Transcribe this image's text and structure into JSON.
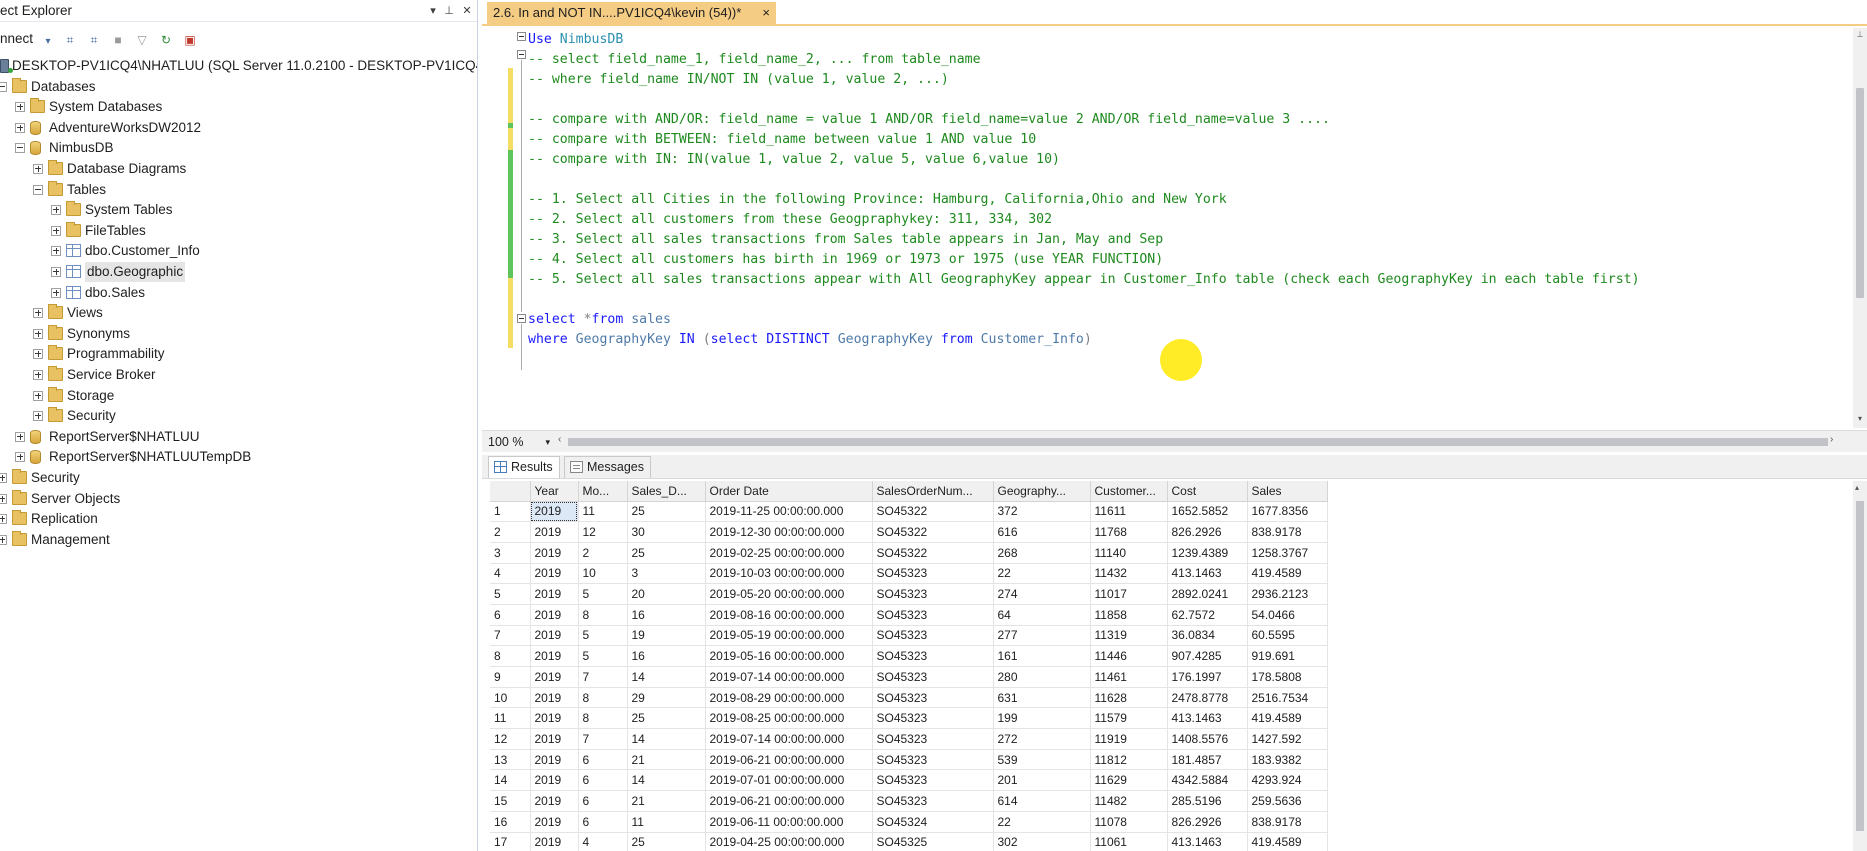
{
  "object_explorer": {
    "title": "ect Explorer",
    "connect_label": "nnect",
    "tree": [
      {
        "label": "DESKTOP-PV1ICQ4\\NHATLUU (SQL Server 11.0.2100 - DESKTOP-PV1ICQ4\\N",
        "icon": "server-icon",
        "level": 0,
        "expander": "none"
      },
      {
        "label": "Databases",
        "icon": "folder-icon",
        "level": 0,
        "expander": "minus"
      },
      {
        "label": "System Databases",
        "icon": "folder-icon",
        "level": 1,
        "expander": "plus"
      },
      {
        "label": "AdventureWorksDW2012",
        "icon": "database-icon",
        "level": 1,
        "expander": "plus"
      },
      {
        "label": "NimbusDB",
        "icon": "database-icon",
        "level": 1,
        "expander": "minus"
      },
      {
        "label": "Database Diagrams",
        "icon": "folder-icon",
        "level": 2,
        "expander": "plus"
      },
      {
        "label": "Tables",
        "icon": "folder-icon",
        "level": 2,
        "expander": "minus"
      },
      {
        "label": "System Tables",
        "icon": "folder-icon",
        "level": 3,
        "expander": "plus"
      },
      {
        "label": "FileTables",
        "icon": "folder-icon",
        "level": 3,
        "expander": "plus"
      },
      {
        "label": "dbo.Customer_Info",
        "icon": "table-icon",
        "level": 3,
        "expander": "plus"
      },
      {
        "label": "dbo.Geographic",
        "icon": "table-icon",
        "level": 3,
        "expander": "plus",
        "selected": true
      },
      {
        "label": "dbo.Sales",
        "icon": "table-icon",
        "level": 3,
        "expander": "plus"
      },
      {
        "label": "Views",
        "icon": "folder-icon",
        "level": 2,
        "expander": "plus"
      },
      {
        "label": "Synonyms",
        "icon": "folder-icon",
        "level": 2,
        "expander": "plus"
      },
      {
        "label": "Programmability",
        "icon": "folder-icon",
        "level": 2,
        "expander": "plus"
      },
      {
        "label": "Service Broker",
        "icon": "folder-icon",
        "level": 2,
        "expander": "plus"
      },
      {
        "label": "Storage",
        "icon": "folder-icon",
        "level": 2,
        "expander": "plus"
      },
      {
        "label": "Security",
        "icon": "folder-icon",
        "level": 2,
        "expander": "plus"
      },
      {
        "label": "ReportServer$NHATLUU",
        "icon": "database-icon",
        "level": 1,
        "expander": "plus"
      },
      {
        "label": "ReportServer$NHATLUUTempDB",
        "icon": "database-icon",
        "level": 1,
        "expander": "plus"
      },
      {
        "label": "Security",
        "icon": "folder-icon",
        "level": 0,
        "expander": "plus"
      },
      {
        "label": "Server Objects",
        "icon": "folder-icon",
        "level": 0,
        "expander": "plus"
      },
      {
        "label": "Replication",
        "icon": "folder-icon",
        "level": 0,
        "expander": "plus"
      },
      {
        "label": "Management",
        "icon": "folder-icon",
        "level": 0,
        "expander": "plus"
      }
    ]
  },
  "document": {
    "tab_title": "2.6. In and NOT IN....PV1ICQ4\\kevin (54))*",
    "tab_close": "×",
    "zoom": "100 %",
    "code_lines": [
      [
        {
          "t": "Use ",
          "c": "kw"
        },
        {
          "t": "NimbusDB",
          "c": "id"
        }
      ],
      [
        {
          "t": "-- select field_name_1, field_name_2, ... from table_name",
          "c": "cm"
        }
      ],
      [
        {
          "t": "-- where field_name IN/NOT IN (value 1, value 2, ...)",
          "c": "cm"
        }
      ],
      [],
      [
        {
          "t": "-- compare with AND/OR: field_name = value 1 AND/OR field_name=value 2 AND/OR field_name=value 3 ....",
          "c": "cm"
        }
      ],
      [
        {
          "t": "-- compare with BETWEEN: field_name between value 1 AND value 10",
          "c": "cm"
        }
      ],
      [
        {
          "t": "-- compare with IN: IN(value 1, value 2, value 5, value 6,value 10)",
          "c": "cm"
        }
      ],
      [],
      [
        {
          "t": "-- 1. Select all Cities in the following Province: Hamburg, California,Ohio and New York",
          "c": "cm"
        }
      ],
      [
        {
          "t": "-- 2. Select all customers from these Geogpraphykey: 311, 334, 302",
          "c": "cm"
        }
      ],
      [
        {
          "t": "-- 3. Select all sales transactions from Sales table appears in Jan, May and Sep",
          "c": "cm"
        }
      ],
      [
        {
          "t": "-- 4. Select all customers has birth in 1969 or 1973 or 1975 (use YEAR FUNCTION)",
          "c": "cm"
        }
      ],
      [
        {
          "t": "-- 5. Select all sales transactions appear with All GeographyKey appear in Customer_Info table (check each GeographyKey in each table first)",
          "c": "cm"
        }
      ],
      [],
      [
        {
          "t": "select ",
          "c": "kw"
        },
        {
          "t": "*",
          "c": "op"
        },
        {
          "t": "from ",
          "c": "kw"
        },
        {
          "t": "sales",
          "c": "id2"
        }
      ],
      [
        {
          "t": "where ",
          "c": "kw"
        },
        {
          "t": "GeographyKey ",
          "c": "id2"
        },
        {
          "t": "IN ",
          "c": "kw"
        },
        {
          "t": "(",
          "c": "op"
        },
        {
          "t": "select ",
          "c": "kw"
        },
        {
          "t": "DISTINCT ",
          "c": "kw"
        },
        {
          "t": "GeographyKey ",
          "c": "id2"
        },
        {
          "t": "from ",
          "c": "kw"
        },
        {
          "t": "Customer_Info",
          "c": "id2"
        },
        {
          "t": ")",
          "c": "op"
        }
      ]
    ]
  },
  "results": {
    "tabs": [
      {
        "label": "Results",
        "active": true
      },
      {
        "label": "Messages",
        "active": false
      }
    ],
    "columns": [
      "Year",
      "Mo...",
      "Sales_D...",
      "Order Date",
      "SalesOrderNum...",
      "Geography...",
      "Customer...",
      "Cost",
      "Sales"
    ],
    "rows": [
      [
        "1",
        "2019",
        "11",
        "25",
        "2019-11-25 00:00:00.000",
        "SO45322",
        "372",
        "11611",
        "1652.5852",
        "1677.8356"
      ],
      [
        "2",
        "2019",
        "12",
        "30",
        "2019-12-30 00:00:00.000",
        "SO45322",
        "616",
        "11768",
        "826.2926",
        "838.9178"
      ],
      [
        "3",
        "2019",
        "2",
        "25",
        "2019-02-25 00:00:00.000",
        "SO45322",
        "268",
        "11140",
        "1239.4389",
        "1258.3767"
      ],
      [
        "4",
        "2019",
        "10",
        "3",
        "2019-10-03 00:00:00.000",
        "SO45323",
        "22",
        "11432",
        "413.1463",
        "419.4589"
      ],
      [
        "5",
        "2019",
        "5",
        "20",
        "2019-05-20 00:00:00.000",
        "SO45323",
        "274",
        "11017",
        "2892.0241",
        "2936.2123"
      ],
      [
        "6",
        "2019",
        "8",
        "16",
        "2019-08-16 00:00:00.000",
        "SO45323",
        "64",
        "11858",
        "62.7572",
        "54.0466"
      ],
      [
        "7",
        "2019",
        "5",
        "19",
        "2019-05-19 00:00:00.000",
        "SO45323",
        "277",
        "11319",
        "36.0834",
        "60.5595"
      ],
      [
        "8",
        "2019",
        "5",
        "16",
        "2019-05-16 00:00:00.000",
        "SO45323",
        "161",
        "11446",
        "907.4285",
        "919.691"
      ],
      [
        "9",
        "2019",
        "7",
        "14",
        "2019-07-14 00:00:00.000",
        "SO45323",
        "280",
        "11461",
        "176.1997",
        "178.5808"
      ],
      [
        "10",
        "2019",
        "8",
        "29",
        "2019-08-29 00:00:00.000",
        "SO45323",
        "631",
        "11628",
        "2478.8778",
        "2516.7534"
      ],
      [
        "11",
        "2019",
        "8",
        "25",
        "2019-08-25 00:00:00.000",
        "SO45323",
        "199",
        "11579",
        "413.1463",
        "419.4589"
      ],
      [
        "12",
        "2019",
        "7",
        "14",
        "2019-07-14 00:00:00.000",
        "SO45323",
        "272",
        "11919",
        "1408.5576",
        "1427.592"
      ],
      [
        "13",
        "2019",
        "6",
        "21",
        "2019-06-21 00:00:00.000",
        "SO45323",
        "539",
        "11812",
        "181.4857",
        "183.9382"
      ],
      [
        "14",
        "2019",
        "6",
        "14",
        "2019-07-01 00:00:00.000",
        "SO45323",
        "201",
        "11629",
        "4342.5884",
        "4293.924"
      ],
      [
        "15",
        "2019",
        "6",
        "21",
        "2019-06-21 00:00:00.000",
        "SO45323",
        "614",
        "11482",
        "285.5196",
        "259.5636"
      ],
      [
        "16",
        "2019",
        "6",
        "11",
        "2019-06-11 00:00:00.000",
        "SO45324",
        "22",
        "11078",
        "826.2926",
        "838.9178"
      ],
      [
        "17",
        "2019",
        "4",
        "25",
        "2019-04-25 00:00:00.000",
        "SO45325",
        "302",
        "11061",
        "413.1463",
        "419.4589"
      ]
    ]
  }
}
